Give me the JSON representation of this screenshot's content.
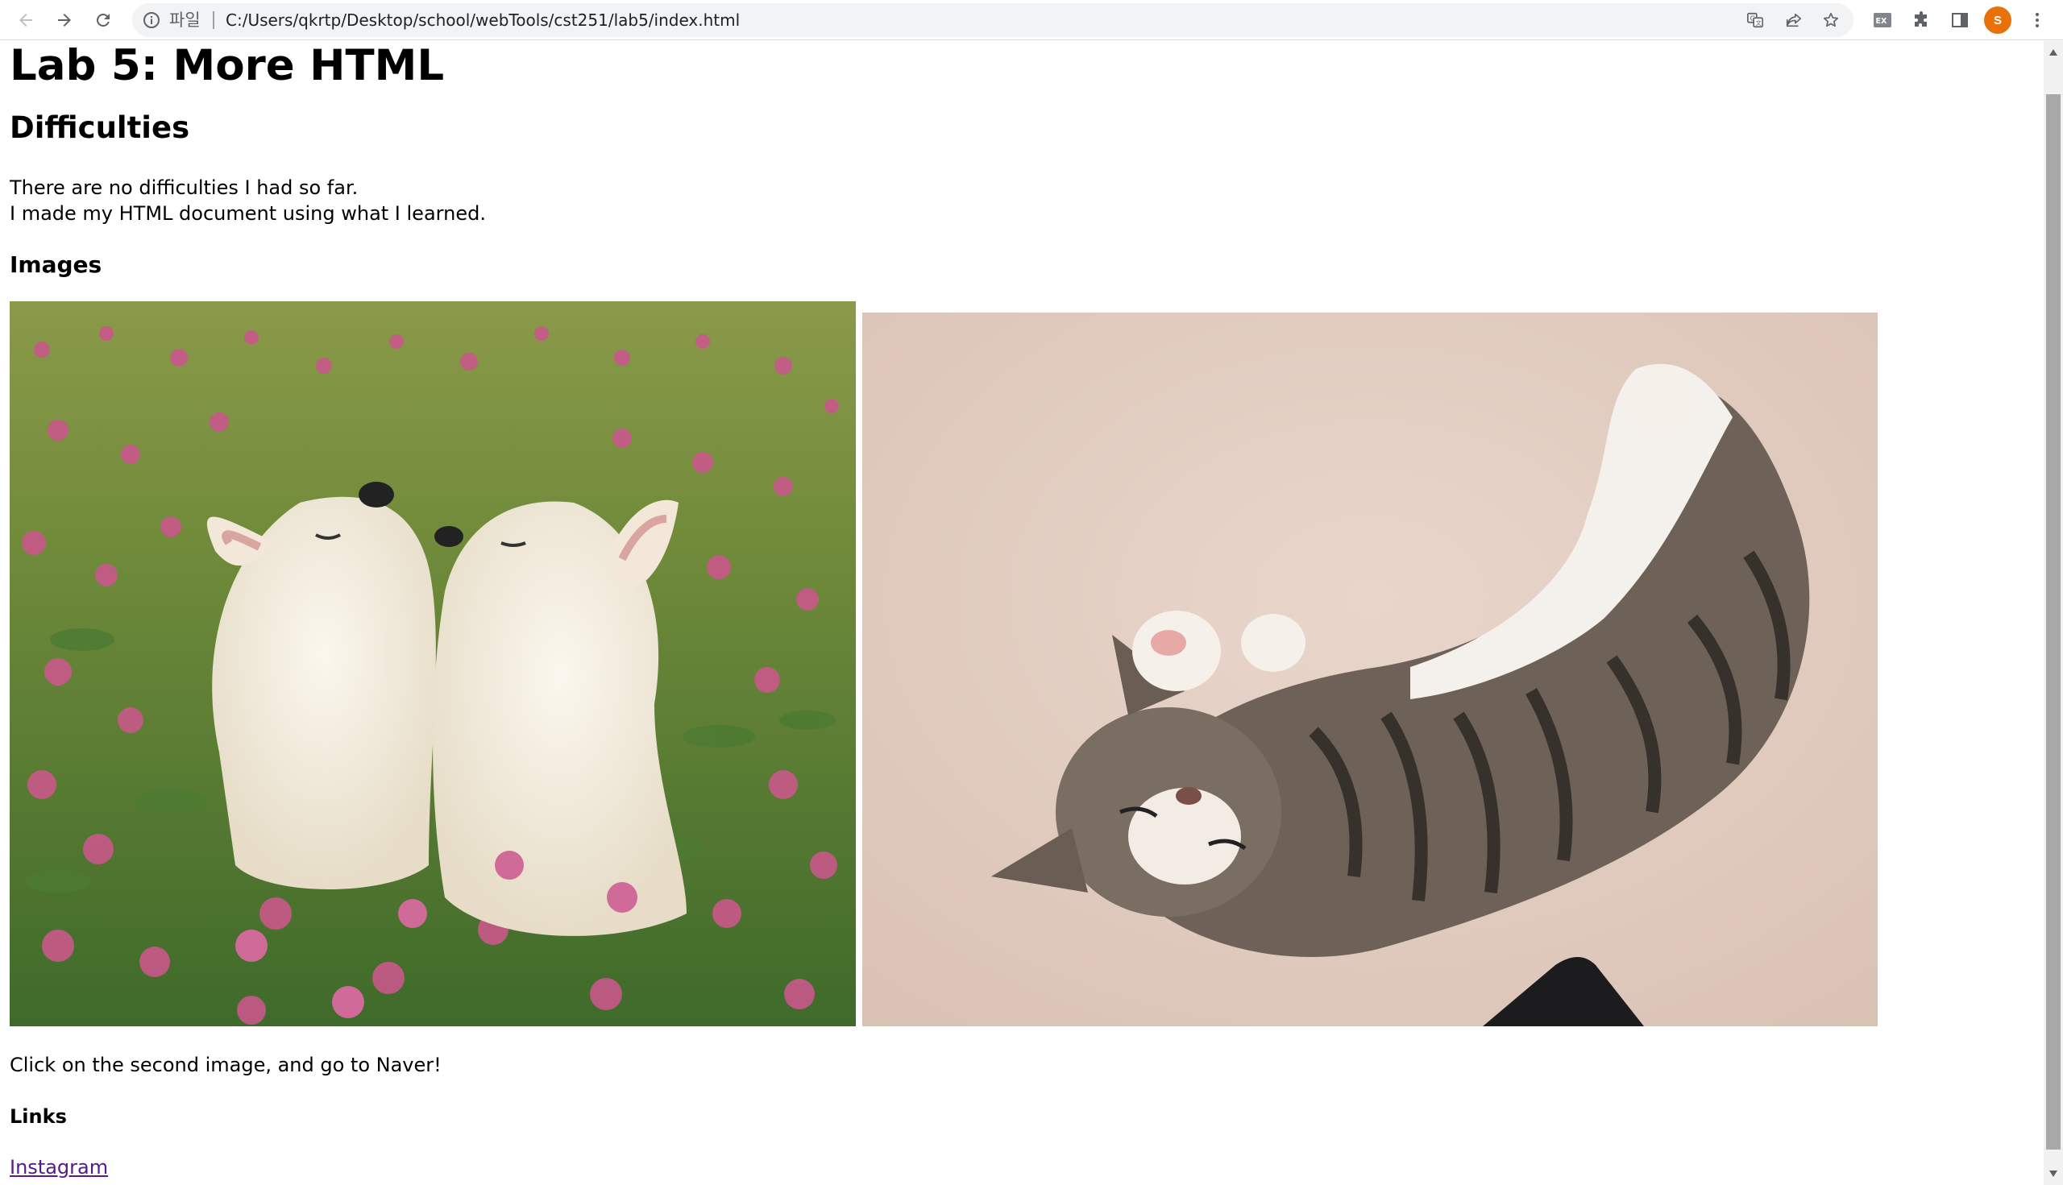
{
  "browser": {
    "scheme_label": "파일",
    "url": "C:/Users/qkrtp/Desktop/school/webTools/cst251/lab5/index.html",
    "profile_initial": "S",
    "profile_color": "#e8710a",
    "icons": {
      "back": "arrow-left-icon",
      "forward": "arrow-right-icon",
      "reload": "reload-icon",
      "site_info": "info-icon",
      "translate": "translate-icon",
      "share": "share-icon",
      "bookmark": "star-icon",
      "extension_ex": "ex-extension-icon",
      "extensions": "puzzle-icon",
      "side_panel": "side-panel-icon",
      "menu": "kebab-menu-icon"
    }
  },
  "page": {
    "title": "Lab 5: More HTML",
    "difficulties_heading": "Difficulties",
    "difficulties_lines": [
      "There are no difficulties I had so far.",
      "I made my HTML document using what I learned."
    ],
    "images_heading": "Images",
    "images": [
      {
        "name": "two white puppies in a field of pink flowers"
      },
      {
        "name": "grey tabby kitten sleeping on its back"
      }
    ],
    "image_caption": "Click on the second image, and go to Naver!",
    "links_heading": "Links",
    "links": [
      {
        "label": "Instagram"
      }
    ],
    "link_color": "#551a8b"
  }
}
